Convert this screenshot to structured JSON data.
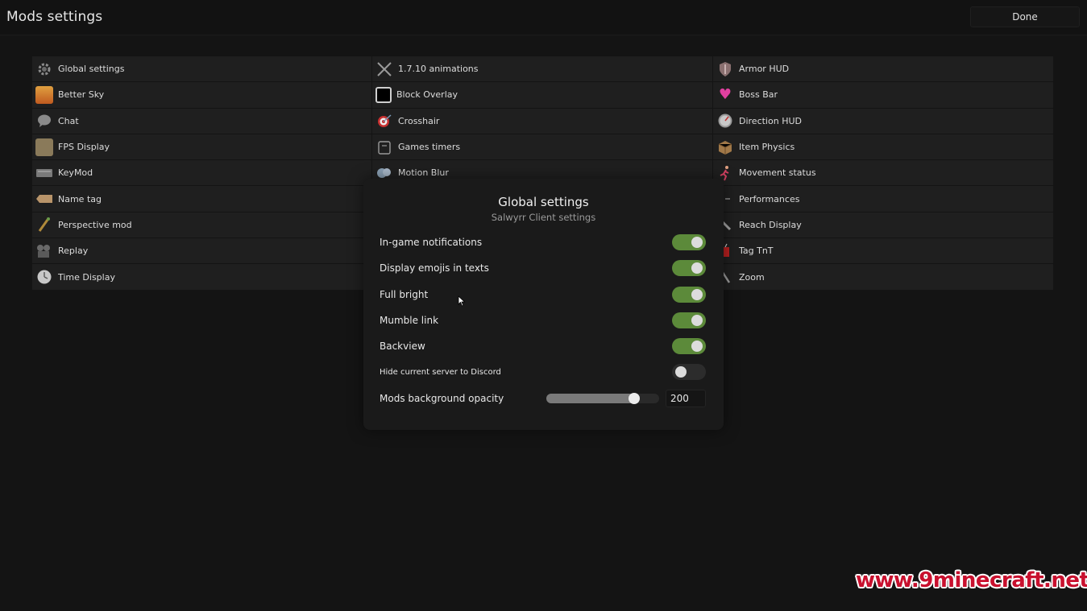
{
  "header": {
    "title": "Mods settings",
    "done_label": "Done"
  },
  "mods": {
    "column1": [
      {
        "label": "Global settings",
        "icon": "gear-icon"
      },
      {
        "label": "Better Sky",
        "icon": "sky-icon"
      },
      {
        "label": "Chat",
        "icon": "chat-bubble-icon"
      },
      {
        "label": "FPS Display",
        "icon": "fps-icon"
      },
      {
        "label": "KeyMod",
        "icon": "keyboard-icon"
      },
      {
        "label": "Name tag",
        "icon": "name-tag-icon"
      },
      {
        "label": "Perspective mod",
        "icon": "perspective-icon"
      },
      {
        "label": "Replay",
        "icon": "camera-icon"
      },
      {
        "label": "Time Display",
        "icon": "clock-icon"
      }
    ],
    "column2": [
      {
        "label": "1.7.10 animations",
        "icon": "crossed-swords-icon"
      },
      {
        "label": "Block Overlay",
        "icon": "block-icon"
      },
      {
        "label": "Crosshair",
        "icon": "target-icon"
      },
      {
        "label": "Games timers",
        "icon": "stopwatch-icon"
      },
      {
        "label": "Motion Blur",
        "icon": "blur-icon"
      }
    ],
    "column3": [
      {
        "label": "Armor HUD",
        "icon": "shield-icon"
      },
      {
        "label": "Boss Bar",
        "icon": "heart-icon"
      },
      {
        "label": "Direction HUD",
        "icon": "compass-icon"
      },
      {
        "label": "Item Physics",
        "icon": "box-icon"
      },
      {
        "label": "Movement status",
        "icon": "running-icon"
      },
      {
        "label": "Performances",
        "icon": "dash-icon"
      },
      {
        "label": "Reach Display",
        "icon": "sword-icon"
      },
      {
        "label": "Tag TnT",
        "icon": "tnt-icon"
      },
      {
        "label": "Zoom",
        "icon": "magnifier-icon"
      }
    ]
  },
  "modal": {
    "title": "Global settings",
    "subtitle": "Salwyrr Client settings",
    "settings": [
      {
        "label": "In-game notifications",
        "enabled": true
      },
      {
        "label": "Display emojis in texts",
        "enabled": true
      },
      {
        "label": "Full bright",
        "enabled": true
      },
      {
        "label": "Mumble link",
        "enabled": true
      },
      {
        "label": "Backview",
        "enabled": true
      },
      {
        "label": "Hide current server to Discord",
        "enabled": false
      }
    ],
    "opacity": {
      "label": "Mods background opacity",
      "value": "200",
      "fraction": 0.78
    }
  },
  "watermark": "www.9minecraft.net",
  "colors": {
    "toggle_on": "#5c8a3a",
    "toggle_off": "#2c2c2c",
    "background": "#141414",
    "panel": "#1f1f1f",
    "watermark": "#c8102e"
  }
}
